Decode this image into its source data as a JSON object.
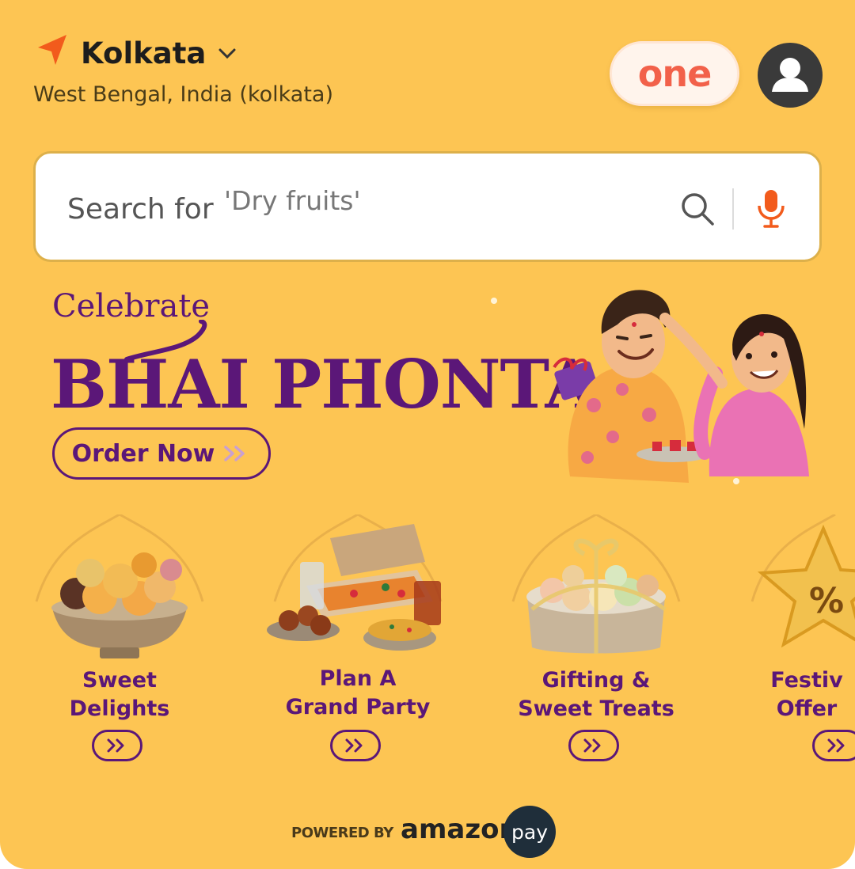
{
  "header": {
    "city": "Kolkata",
    "region": "West Bengal, India (kolkata)",
    "membership_label": "one"
  },
  "search": {
    "label": "Search for",
    "placeholder": "'Dry fruits'"
  },
  "banner": {
    "kicker": "Celebrate",
    "title": "BHAI PHONTA",
    "cta": "Order Now"
  },
  "categories": [
    {
      "line1": "Sweet",
      "line2": "Delights"
    },
    {
      "line1": "Plan A",
      "line2": "Grand Party"
    },
    {
      "line1": "Gifting &",
      "line2": "Sweet Treats"
    },
    {
      "line1": "Festiv",
      "line2": "Offer"
    }
  ],
  "footer": {
    "powered_by": "POWERED BY",
    "brand": "amazon",
    "pay": "pay"
  },
  "colors": {
    "background": "#fdc553",
    "accent_purple": "#5b1778",
    "accent_orange": "#f2614a"
  },
  "icons": [
    "location-arrow-icon",
    "chevron-down-icon",
    "user-icon",
    "search-icon",
    "mic-icon",
    "double-chevron-right-icon"
  ]
}
